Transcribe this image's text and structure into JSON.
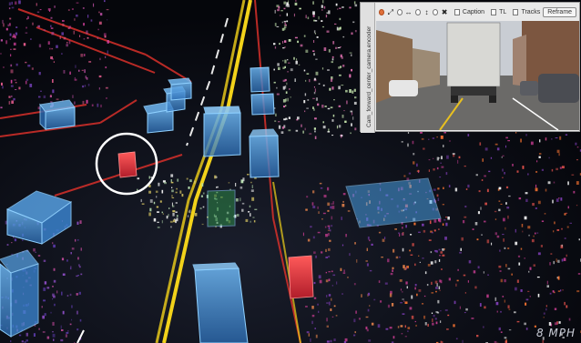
{
  "camera_panel": {
    "topic_label": "Cam_forward_center_camera.encoder",
    "toolbar": {
      "checkboxes": [
        {
          "label": "Caption"
        },
        {
          "label": "TL"
        },
        {
          "label": "Tracks"
        }
      ],
      "reframe_label": "Reframe"
    }
  },
  "hud": {
    "speed_text": "8 MPH"
  },
  "colors": {
    "box_blue": "#4aa0e6",
    "box_red": "#e0303a",
    "lane_yellow": "#f2d21a",
    "lane_white": "#e8e8e8",
    "road_edge_red": "#d8302a",
    "highlight_circle": "#ffffff"
  }
}
